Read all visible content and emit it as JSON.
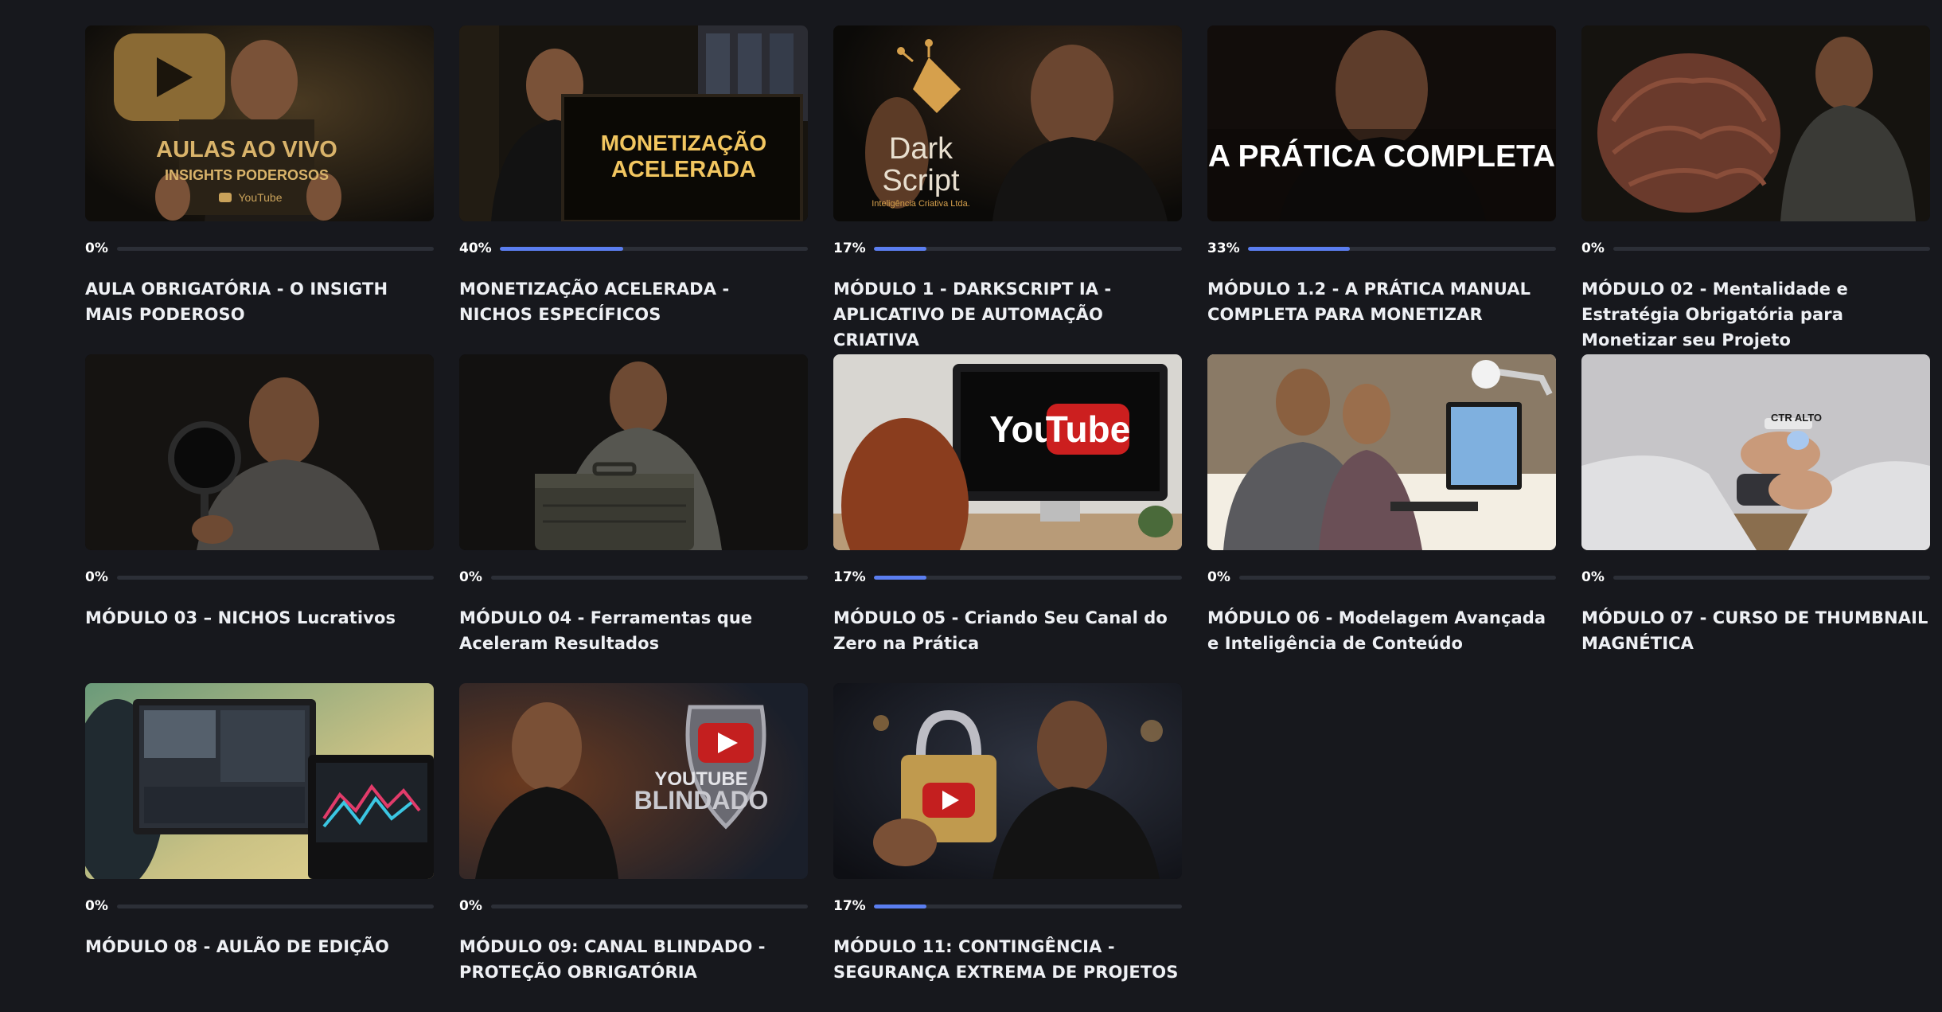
{
  "accent_color": "#5b7ef0",
  "modules": [
    {
      "title": "AULA OBRIGATÓRIA - O INSIGTH MAIS PODEROSO",
      "progress": 0,
      "progress_label": "0%",
      "thumb_text": [
        "AULAS AO VIVO",
        "INSIGHTS PODEROSOS",
        "YouTube"
      ]
    },
    {
      "title": "MONETIZAÇÃO ACELERADA - NICHOS ESPECÍFICOS",
      "progress": 40,
      "progress_label": "40%",
      "thumb_text": [
        "MONETIZAÇÃO",
        "ACELERADA"
      ]
    },
    {
      "title": "MÓDULO 1 - DARKSCRIPT IA - APLICATIVO DE AUTOMAÇÃO CRIATIVA",
      "progress": 17,
      "progress_label": "17%",
      "thumb_text": [
        "Dark",
        "Script",
        "Inteligência Criativa Ltda."
      ]
    },
    {
      "title": "MÓDULO 1.2 - A PRÁTICA MANUAL COMPLETA PARA MONETIZAR",
      "progress": 33,
      "progress_label": "33%",
      "thumb_text": [
        "A PRÁTICA COMPLETA"
      ]
    },
    {
      "title": "MÓDULO 02 - Mentalidade e Estratégia Obrigatória para Monetizar seu Projeto",
      "progress": 0,
      "progress_label": "0%",
      "thumb_text": []
    },
    {
      "title": "MÓDULO 03 – NICHOS Lucrativos",
      "progress": 0,
      "progress_label": "0%",
      "thumb_text": []
    },
    {
      "title": "MÓDULO 04 - Ferramentas que Aceleram Resultados",
      "progress": 0,
      "progress_label": "0%",
      "thumb_text": []
    },
    {
      "title": "MÓDULO 05 - Criando Seu Canal do Zero na Prática",
      "progress": 17,
      "progress_label": "17%",
      "thumb_text": [
        "You",
        "Tube"
      ]
    },
    {
      "title": "MÓDULO 06 - Modelagem Avançada e Inteligência de Conteúdo",
      "progress": 0,
      "progress_label": "0%",
      "thumb_text": []
    },
    {
      "title": "MÓDULO 07 - CURSO DE THUMBNAIL MAGNÉTICA",
      "progress": 0,
      "progress_label": "0%",
      "thumb_text": [
        "CTR ALTO"
      ]
    },
    {
      "title": "MÓDULO 08 - AULÃO DE EDIÇÃO",
      "progress": 0,
      "progress_label": "0%",
      "thumb_text": []
    },
    {
      "title": "MÓDULO 09: CANAL BLINDADO - PROTEÇÃO OBRIGATÓRIA",
      "progress": 0,
      "progress_label": "0%",
      "thumb_text": [
        "YOUTUBE",
        "BLINDADO"
      ]
    },
    {
      "title": "MÓDULO 11: CONTINGÊNCIA - SEGURANÇA EXTREMA DE PROJETOS",
      "progress": 17,
      "progress_label": "17%",
      "thumb_text": []
    }
  ]
}
